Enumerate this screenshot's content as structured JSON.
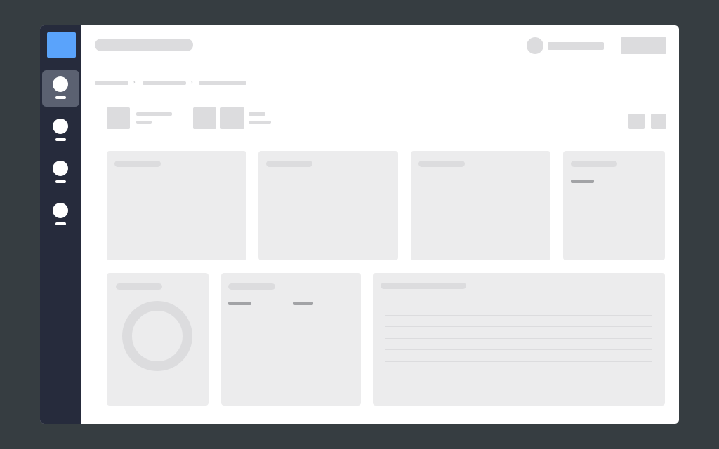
{
  "theme": {
    "sidebar_bg": "#262b3c",
    "sidebar_active_bg": "#5b6171",
    "accent": "#5aa3fb",
    "skeleton": "#dcdcde",
    "card_bg": "#ececed",
    "backdrop": "#363d41"
  },
  "sidebar": {
    "logo_icon": "app-logo-icon",
    "items": [
      {
        "icon": "circle-icon",
        "active": true
      },
      {
        "icon": "circle-icon",
        "active": false
      },
      {
        "icon": "circle-icon",
        "active": false
      },
      {
        "icon": "circle-icon",
        "active": false
      }
    ]
  },
  "header": {
    "breadcrumb_separator": "›"
  }
}
